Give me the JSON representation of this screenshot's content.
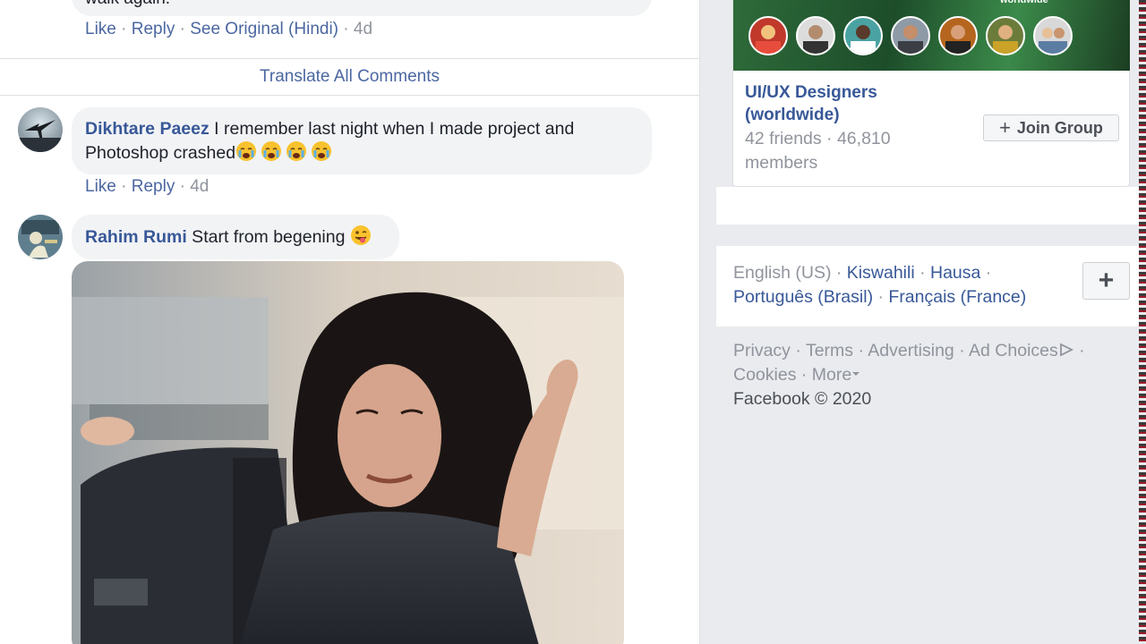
{
  "prev_comment": {
    "text_fragment": "walk again.",
    "actions": {
      "like": "Like",
      "reply": "Reply",
      "see_original": "See Original (Hindi)",
      "sep": "·",
      "age": "4d"
    }
  },
  "translate_all": "Translate All Comments",
  "comments": [
    {
      "author": "Dikhtare Paeez",
      "text": " I remember last night when I made project and Photoshop crashed",
      "emojis": [
        "crying-face",
        "crying-face",
        "crying-face",
        "crying-face"
      ],
      "actions": {
        "like": "Like",
        "reply": "Reply",
        "sep": "·",
        "age": "4d"
      }
    },
    {
      "author": "Rahim Rumi",
      "text": " Start from begening ",
      "emojis": [
        "winking-tongue-face"
      ],
      "attachment": "gif"
    }
  ],
  "group": {
    "name": "UI/UX Designers (worldwide)",
    "meta": "42 friends · 46,810 members",
    "join_label": "Join Group",
    "join_icon": "plus-icon",
    "cover_badge": "worldwide"
  },
  "languages": {
    "current": "English (US)",
    "items": [
      "Kiswahili",
      "Hausa",
      "Português (Brasil)",
      "Français (France)"
    ],
    "sep": "·",
    "more_icon": "+"
  },
  "footer": {
    "links": [
      "Privacy",
      "Terms",
      "Advertising",
      "Ad Choices",
      "Cookies",
      "More"
    ],
    "sep": "·",
    "copyright": "Facebook © 2020"
  },
  "colors": {
    "link": "#385898",
    "muted": "#90949c",
    "bubble": "#f2f3f5",
    "page_bg": "#e9ebee"
  }
}
